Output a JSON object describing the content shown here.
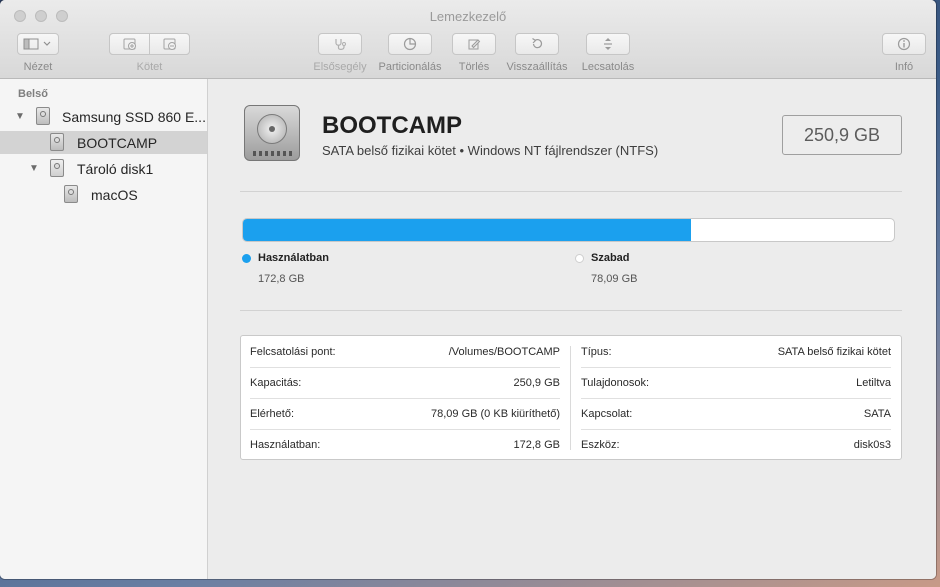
{
  "window": {
    "title": "Lemezkezelő"
  },
  "toolbar": {
    "view_label": "Nézet",
    "volume_label": "Kötet",
    "firstaid_label": "Elsősegély",
    "partition_label": "Particionálás",
    "erase_label": "Törlés",
    "restore_label": "Visszaállítás",
    "unmount_label": "Lecsatolás",
    "info_label": "Infó"
  },
  "sidebar": {
    "section": "Belső",
    "items": [
      {
        "label": "Samsung SSD 860 E...",
        "level": 0,
        "expanded": true
      },
      {
        "label": "BOOTCAMP",
        "level": 1,
        "selected": true
      },
      {
        "label": "Tároló disk1",
        "level": 1,
        "expanded": true
      },
      {
        "label": "macOS",
        "level": 2
      }
    ]
  },
  "volume": {
    "name": "BOOTCAMP",
    "description": "SATA belső fizikai kötet • Windows NT fájlrendszer (NTFS)",
    "capacity": "250,9 GB"
  },
  "usage": {
    "used_fraction": 0.688,
    "used_color": "#1ba0ee",
    "free_color": "#ffffff",
    "used_title": "Használatban",
    "used_value": "172,8 GB",
    "free_title": "Szabad",
    "free_value": "78,09 GB"
  },
  "info": {
    "left": [
      {
        "label": "Felcsatolási pont:",
        "value": "/Volumes/BOOTCAMP"
      },
      {
        "label": "Kapacitás:",
        "value": "250,9 GB"
      },
      {
        "label": "Elérhető:",
        "value": "78,09 GB (0 KB kiüríthető)"
      },
      {
        "label": "Használatban:",
        "value": "172,8 GB"
      }
    ],
    "right": [
      {
        "label": "Típus:",
        "value": "SATA belső fizikai kötet"
      },
      {
        "label": "Tulajdonosok:",
        "value": "Letiltva"
      },
      {
        "label": "Kapcsolat:",
        "value": "SATA"
      },
      {
        "label": "Eszköz:",
        "value": "disk0s3"
      }
    ]
  }
}
